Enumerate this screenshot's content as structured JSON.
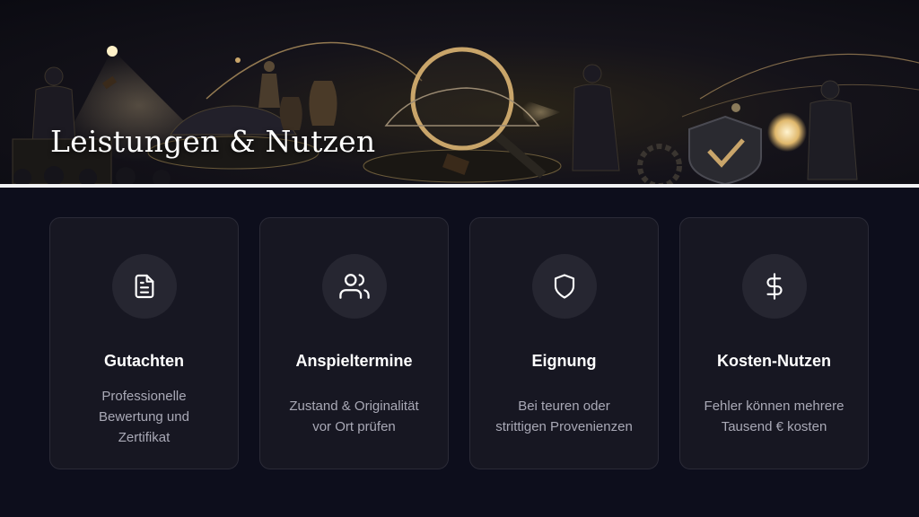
{
  "hero": {
    "title": "Leistungen & Nutzen"
  },
  "cards": [
    {
      "icon": "document-icon",
      "title": "Gutachten",
      "lines": [
        "Professionelle",
        "Bewertung und",
        "Zertifikat"
      ]
    },
    {
      "icon": "users-icon",
      "title": "Anspieltermine",
      "lines": [
        "Zustand & Originalität",
        "vor Ort prüfen"
      ]
    },
    {
      "icon": "shield-icon",
      "title": "Eignung",
      "lines": [
        "Bei teuren oder",
        "strittigen Provenienzen"
      ]
    },
    {
      "icon": "dollar-icon",
      "title": "Kosten-Nutzen",
      "lines": [
        "Fehler können mehrere",
        "Tausend € kosten"
      ]
    }
  ],
  "colors": {
    "background": "#0d0e1c",
    "card": "#171722",
    "card_border": "#2b2b37",
    "icon_circle": "#262631",
    "text_muted": "#a9a9b6",
    "gold": "#c9a56a"
  }
}
